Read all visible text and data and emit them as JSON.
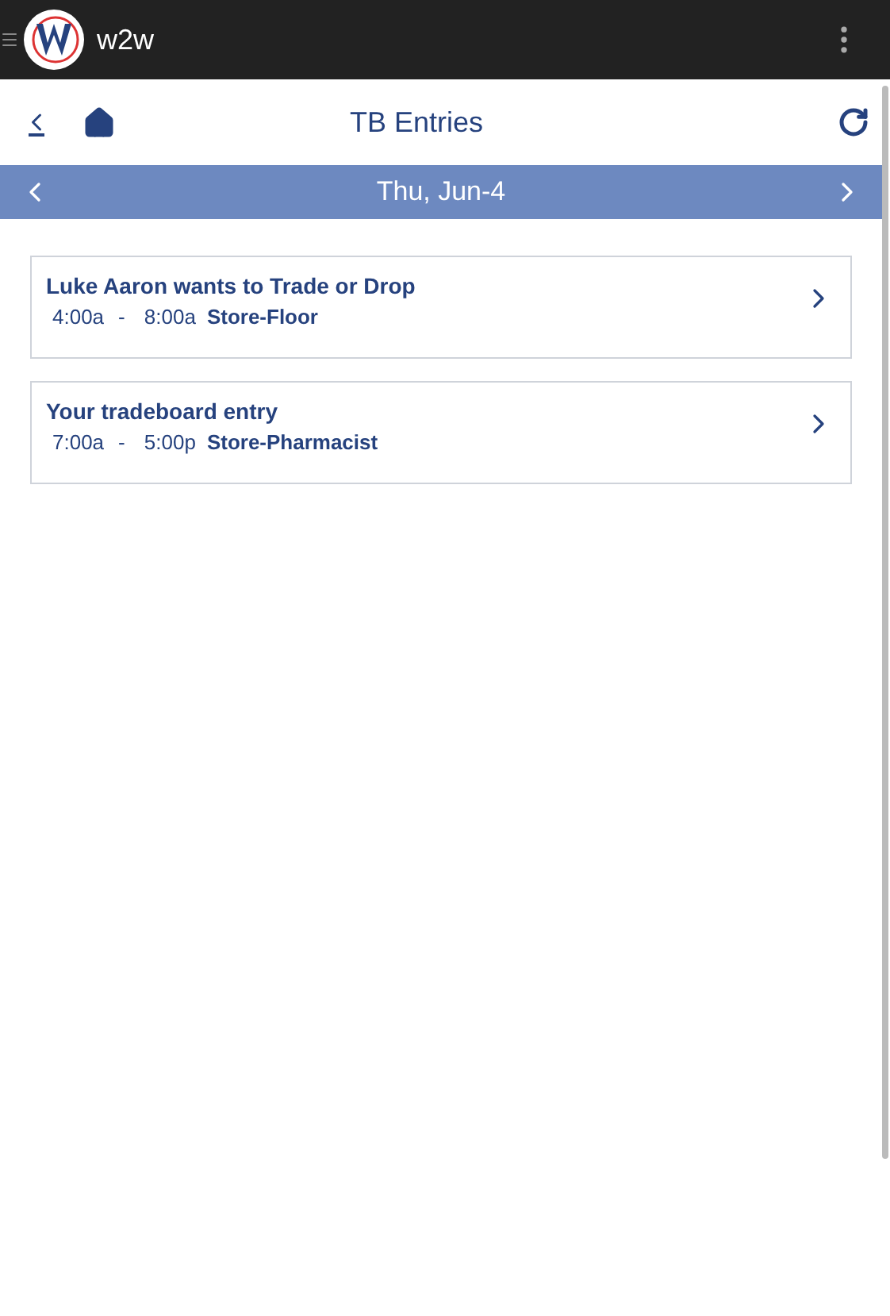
{
  "app_bar": {
    "title": "w2w"
  },
  "header": {
    "title": "TB Entries"
  },
  "date_bar": {
    "label": "Thu, Jun-4"
  },
  "entries": [
    {
      "title": "Luke Aaron wants to Trade or Drop",
      "start": "4:00a",
      "separator": "-",
      "end": "8:00a",
      "location": "Store-Floor"
    },
    {
      "title": "Your tradeboard entry",
      "start": "7:00a",
      "separator": "-",
      "end": "5:00p",
      "location": "Store-Pharmacist"
    }
  ]
}
